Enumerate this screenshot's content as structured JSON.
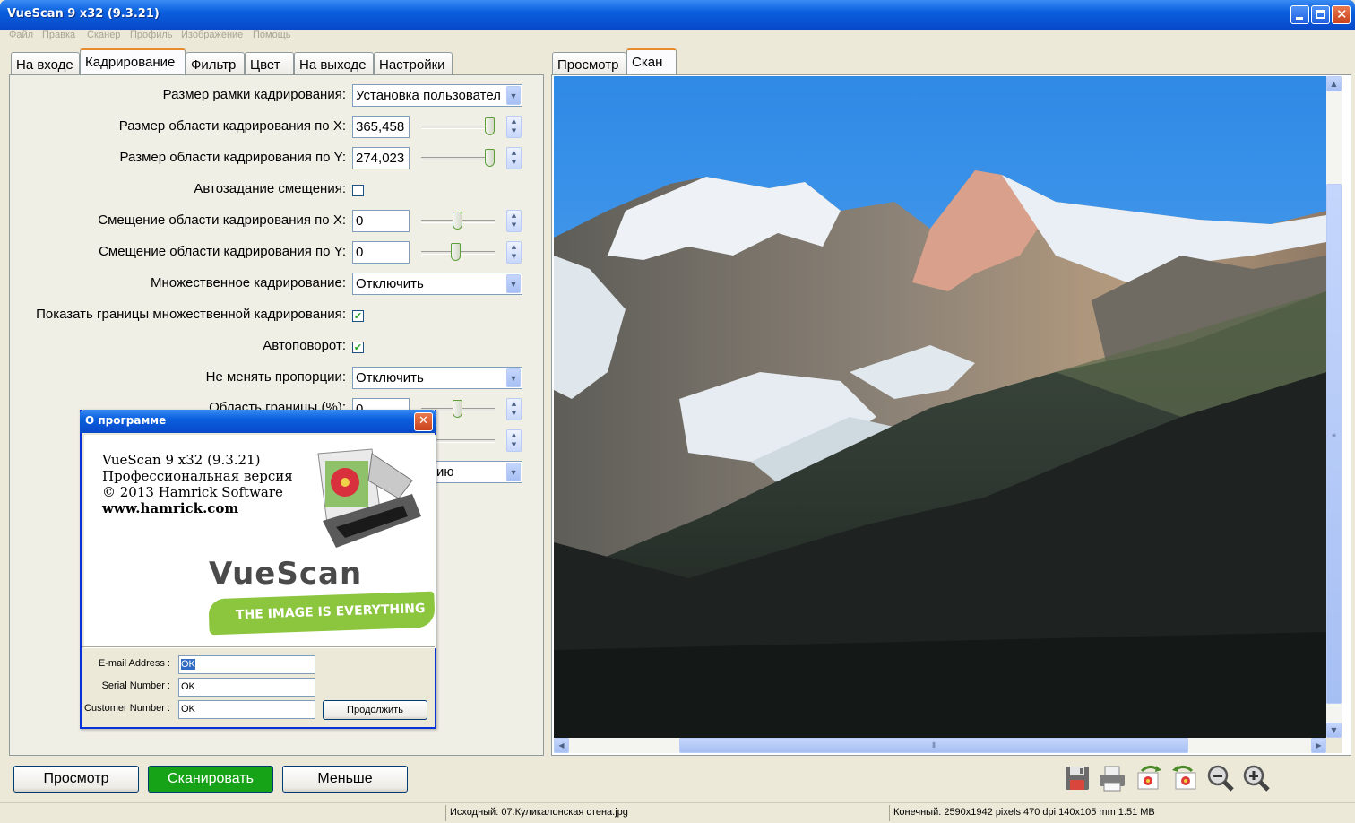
{
  "window": {
    "title": "VueScan 9 x32 (9.3.21)"
  },
  "menu": [
    "Файл",
    "Правка",
    "Сканер",
    "Профиль",
    "Изображение",
    "Помощь"
  ],
  "left_tabs": [
    "На входе",
    "Кадрирование",
    "Фильтр",
    "Цвет",
    "На выходе",
    "Настройки"
  ],
  "right_tabs": [
    "Просмотр",
    "Скан"
  ],
  "crop": {
    "frame_size_label": "Размер рамки кадрирования:",
    "frame_size_value": "Установка пользовател",
    "size_x_label": "Размер области кадрирования по X:",
    "size_x_value": "365,458",
    "size_y_label": "Размер области кадрирования по Y:",
    "size_y_value": "274,023",
    "auto_offset_label": "Автозадание смещения:",
    "offset_x_label": "Смещение области кадрирования по X:",
    "offset_x_value": "0",
    "offset_y_label": "Смещение области кадрирования по Y:",
    "offset_y_value": "0",
    "multi_label": "Множественное кадрирование:",
    "multi_value": "Отключить",
    "show_bounds_label": "Показать границы множественной кадрирования:",
    "autorotate_label": "Автоповорот:",
    "keep_ratio_label": "Не менять пропорции:",
    "keep_ratio_value": "Отключить",
    "border_label": "Область границы (%):",
    "border_value": "0",
    "hidden_combo_value": "ию"
  },
  "buttons": {
    "preview": "Просмотр",
    "scan": "Сканировать",
    "less": "Меньше"
  },
  "status": {
    "source": "Исходный: 07.Куликалонская стена.jpg",
    "output": "Конечный: 2590x1942 pixels 470 dpi 140x105 mm 1.51 MB"
  },
  "about": {
    "title": "О программе",
    "line1": "VueScan 9 x32 (9.3.21)",
    "line2": "Профессиональная версия",
    "line3": "© 2013 Hamrick Software",
    "line4": "www.hamrick.com",
    "logo_text": "VueScan",
    "slogan": "THE IMAGE IS EVERYTHING",
    "email_label": "E-mail Address :",
    "email_value": "OK",
    "serial_label": "Serial Number :",
    "serial_value": "OK",
    "customer_label": "Customer Number :",
    "customer_value": "OK",
    "continue_label": "Продолжить"
  },
  "colors": {
    "scan_button": "#17a317",
    "titlebar": "#0a5fde",
    "sky": "#2f8ae6"
  }
}
